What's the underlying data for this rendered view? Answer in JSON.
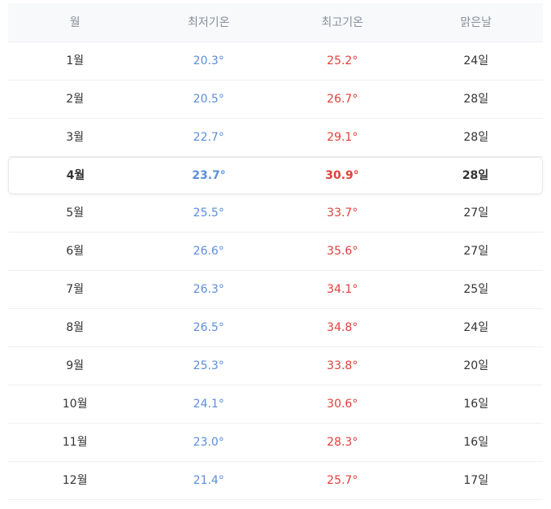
{
  "table": {
    "headers": [
      "월",
      "최저기온",
      "최고기온",
      "맑은날"
    ],
    "rows": [
      {
        "month": "1월",
        "low": "20.3°",
        "high": "25.2°",
        "sunny": "24일"
      },
      {
        "month": "2월",
        "low": "20.5°",
        "high": "26.7°",
        "sunny": "28일"
      },
      {
        "month": "3월",
        "low": "22.7°",
        "high": "29.1°",
        "sunny": "28일"
      },
      {
        "month": "4월",
        "low": "23.7°",
        "high": "30.9°",
        "sunny": "28일"
      },
      {
        "month": "5월",
        "low": "25.5°",
        "high": "33.7°",
        "sunny": "27일"
      },
      {
        "month": "6월",
        "low": "26.6°",
        "high": "35.6°",
        "sunny": "27일"
      },
      {
        "month": "7월",
        "low": "26.3°",
        "high": "34.1°",
        "sunny": "25일"
      },
      {
        "month": "8월",
        "low": "26.5°",
        "high": "34.8°",
        "sunny": "24일"
      },
      {
        "month": "9월",
        "low": "25.3°",
        "high": "33.8°",
        "sunny": "20일"
      },
      {
        "month": "10월",
        "low": "24.1°",
        "high": "30.6°",
        "sunny": "16일"
      },
      {
        "month": "11월",
        "low": "23.0°",
        "high": "28.3°",
        "sunny": "16일"
      },
      {
        "month": "12월",
        "low": "21.4°",
        "high": "25.7°",
        "sunny": "17일"
      }
    ]
  },
  "colors": {
    "low_temp": "#5b8fdc",
    "high_temp": "#e0403a",
    "header_text": "#8a8f98",
    "header_bg": "#f8f9fb"
  }
}
